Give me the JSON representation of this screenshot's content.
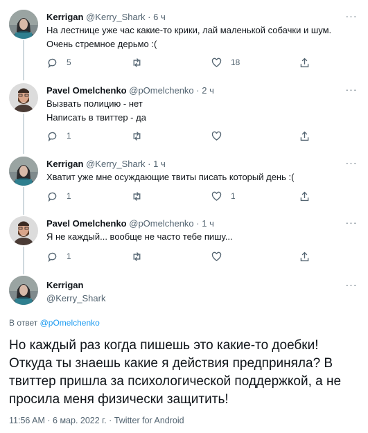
{
  "tweets": [
    {
      "name": "Kerrigan",
      "handle": "@Kerry_Shark",
      "separator": "·",
      "time": "6 ч",
      "text": "На лестнице уже час какие-то крики, лай маленькой собачки и шум. Очень стремное дерьмо :(",
      "replies": "5",
      "retweets": "",
      "likes": "18"
    },
    {
      "name": "Pavel Omelchenko",
      "handle": "@pOmelchenko",
      "separator": "·",
      "time": "2 ч",
      "text_lines": [
        "Вызвать полицию - нет",
        "Написать в твиттер - да"
      ],
      "replies": "1",
      "retweets": "",
      "likes": ""
    },
    {
      "name": "Kerrigan",
      "handle": "@Kerry_Shark",
      "separator": "·",
      "time": "1 ч",
      "text": "Хватит уже мне осуждающие твиты писать который день :(",
      "replies": "1",
      "retweets": "",
      "likes": "1"
    },
    {
      "name": "Pavel Omelchenko",
      "handle": "@pOmelchenko",
      "separator": "·",
      "time": "1 ч",
      "text": "Я не каждый... вообще не часто тебе пишу...",
      "replies": "1",
      "retweets": "",
      "likes": ""
    }
  ],
  "main_tweet": {
    "name": "Kerrigan",
    "handle": "@Kerry_Shark",
    "reply_prefix": "В ответ",
    "reply_handle": "@pOmelchenko",
    "text": "Но каждый раз когда пишешь это какие-то доебки! Откуда ты знаешь какие я действия предприняла? В твиттер пришла за психологической поддержкой, а не просила меня физически защитить!",
    "time": "11:56 AM",
    "separator": "·",
    "date": "6 мар. 2022 г.",
    "source": "Twitter for Android"
  },
  "icons": {
    "reply": "reply-icon",
    "retweet": "retweet-icon",
    "like": "heart-icon",
    "share": "share-icon",
    "more": "more-icon"
  },
  "colors": {
    "text": "#0f1419",
    "secondary": "#536471",
    "link": "#1d9bf0",
    "thread_line": "#cfd9de"
  }
}
